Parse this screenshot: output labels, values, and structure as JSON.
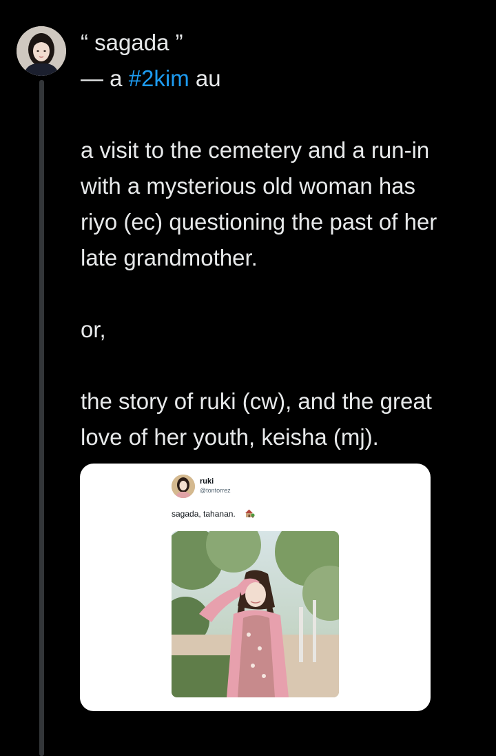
{
  "post": {
    "title_line": "“ sagada ”",
    "subtitle_prefix": "— a ",
    "hashtag": "#2kim",
    "subtitle_suffix": " au",
    "body_lines": [
      "a visit to the cemetery and a run-in",
      "with a mysterious old woman has",
      "riyo (ec) questioning the past of her",
      "late grandmother."
    ],
    "or_line": "or,",
    "closing_lines": [
      "the story of ruki (cw), and the great",
      "love of her youth, keisha (mj)."
    ],
    "colors": {
      "background": "#000000",
      "text": "#e7e9ea",
      "hashtag": "#1d9bf0",
      "thread_line": "#333639"
    }
  },
  "embedded_post": {
    "name": "ruki",
    "handle": "@tontorrez",
    "text": "sagada, tahanan.",
    "emoji_icon": "house-with-garden-icon"
  },
  "icons": {
    "avatar": "profile-avatar",
    "embedded_avatar": "embedded-profile-avatar",
    "photo": "embedded-photo"
  }
}
